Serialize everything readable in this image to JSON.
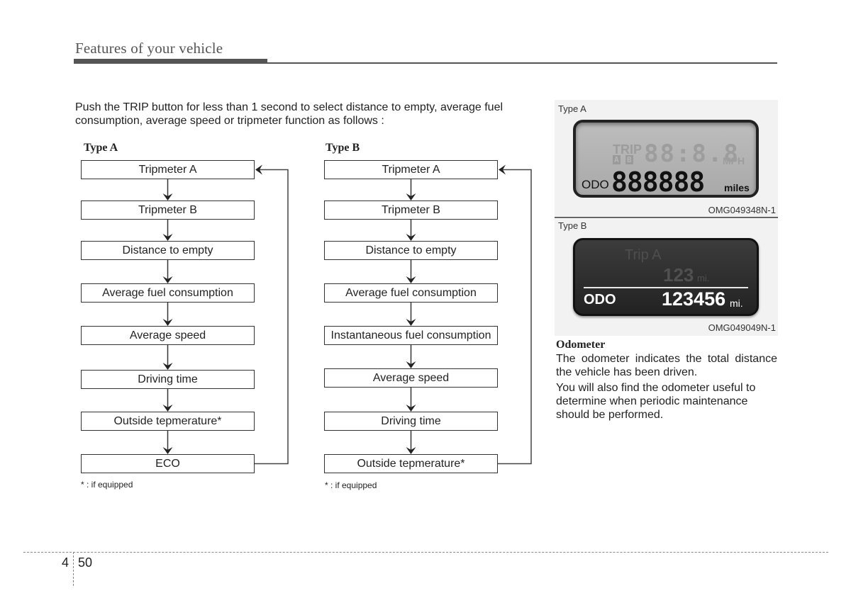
{
  "header": {
    "title": "Features of your vehicle"
  },
  "intro": "Push the TRIP button for less than 1 second to select distance to empty, average fuel consumption, average speed or tripmeter function as follows :",
  "type_a": {
    "title": "Type A",
    "steps": [
      "Tripmeter A",
      "Tripmeter B",
      "Distance to empty",
      "Average fuel consumption",
      "Average speed",
      "Driving time",
      "Outside tepmerature*",
      "ECO"
    ],
    "footnote": "* : if equipped"
  },
  "type_b": {
    "title": "Type B",
    "steps": [
      "Tripmeter A",
      "Tripmeter B",
      "Distance to empty",
      "Average fuel consumption",
      "Instantaneous fuel consumption",
      "Average speed",
      "Driving time",
      "Outside tepmerature*"
    ],
    "footnote": "* : if equipped"
  },
  "figure_a": {
    "label": "Type A",
    "code": "OMG049348N-1",
    "lcd": {
      "trip_label": "TRIP",
      "trip_a": "A",
      "trip_b": "B",
      "trip_digits": "88:8.8",
      "speed_unit": "MPH",
      "odo_label": "ODO",
      "odo_digits": "888888",
      "odo_unit": "miles"
    }
  },
  "figure_b": {
    "label": "Type B",
    "code": "OMG049049N-1",
    "lcd": {
      "trip_label": "Trip A",
      "trip_value": "123",
      "trip_unit": "mi.",
      "odo_label": "ODO",
      "odo_value": "123456",
      "odo_unit": "mi."
    }
  },
  "odometer": {
    "heading": "Odometer",
    "paragraphs": [
      "The odometer indicates the total distance the vehicle has been driven.",
      "You will also find the odometer useful to determine when periodic maintenance should be performed."
    ]
  },
  "footer": {
    "chapter": "4",
    "page": "50"
  }
}
